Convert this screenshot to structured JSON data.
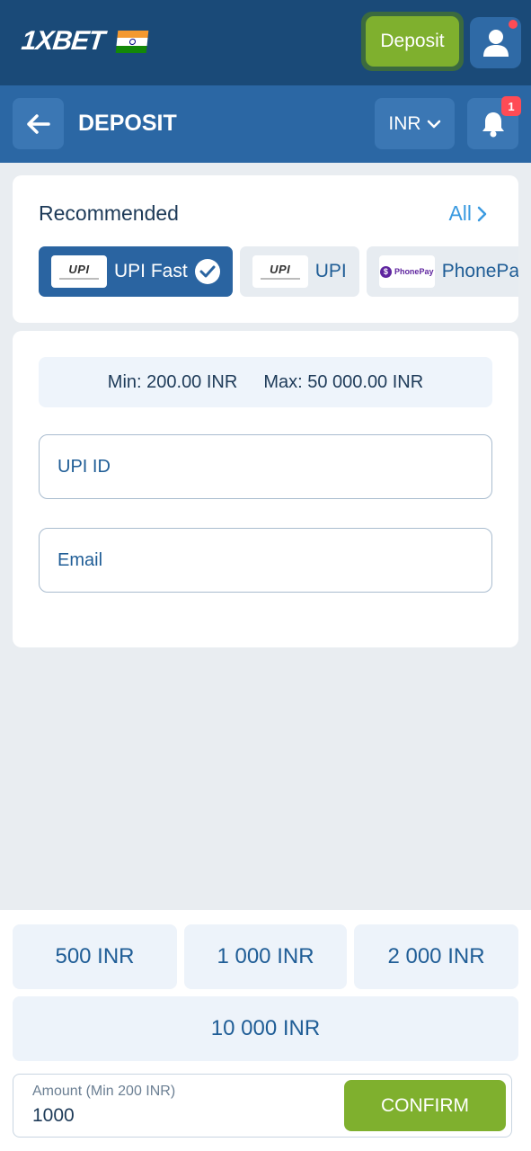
{
  "header": {
    "logo_text": "1XBET",
    "deposit_label": "Deposit",
    "brand_colors": {
      "primary": "#1a4a78",
      "accent": "#7fb02e"
    }
  },
  "subheader": {
    "title": "DEPOSIT",
    "currency": "INR",
    "notification_count": "1"
  },
  "recommended": {
    "title": "Recommended",
    "all_label": "All",
    "methods": [
      {
        "label": "UPI Fast",
        "logo": "UPI",
        "selected": true
      },
      {
        "label": "UPI",
        "logo": "UPI",
        "selected": false
      },
      {
        "label": "PhonePay",
        "logo": "PhonePay",
        "selected": false
      }
    ]
  },
  "form": {
    "min_text": "Min: 200.00 INR",
    "max_text": "Max: 50 000.00 INR",
    "upi_placeholder": "UPI ID",
    "email_placeholder": "Email"
  },
  "quick_amounts": [
    "500 INR",
    "1 000 INR",
    "2 000 INR",
    "10 000 INR"
  ],
  "amount": {
    "label": "Amount (Min 200 INR)",
    "value": "1000",
    "confirm_label": "CONFIRM"
  }
}
